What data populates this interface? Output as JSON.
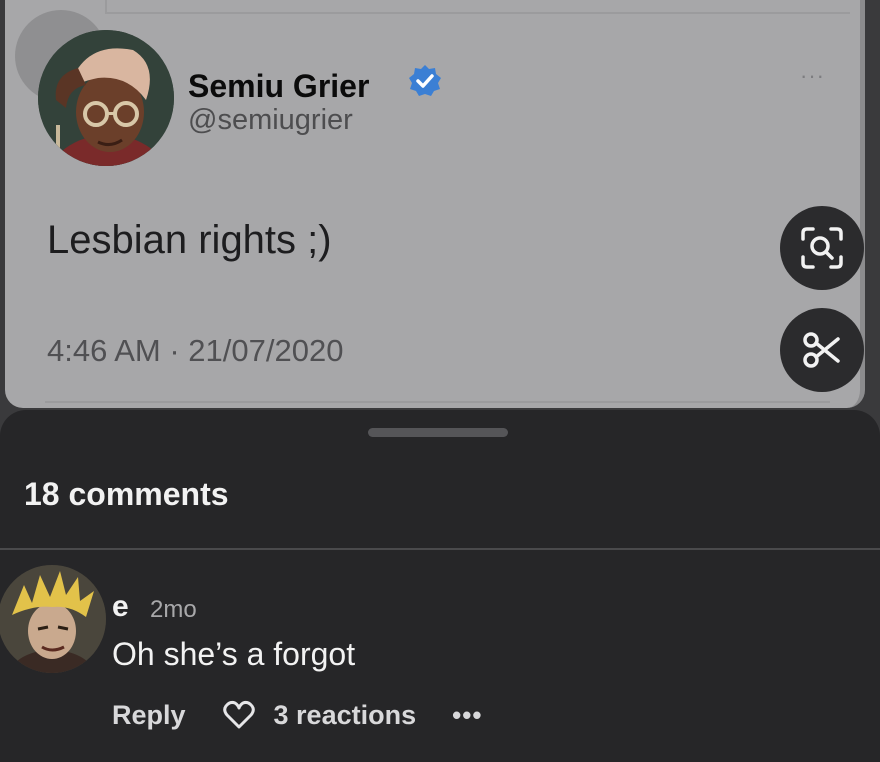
{
  "tweet": {
    "display_name": "Semiu Grier",
    "handle": "@semiugrier",
    "text": "Lesbian rights ;)",
    "timestamp": "4:46 AM · 21/07/2020",
    "more_label": "···",
    "verified_icon": "verified-badge-icon",
    "accent_color": "#3b7fd4"
  },
  "actions": {
    "lens_icon": "visual-search-icon",
    "cut_icon": "scissors-icon"
  },
  "sheet": {
    "comments_count": "18 comments"
  },
  "comment": {
    "user": "e",
    "age": "2mo",
    "text": "Oh she’s a forgot",
    "reply_label": "Reply",
    "reactions_label": "3 reactions",
    "more_label": "•••"
  }
}
